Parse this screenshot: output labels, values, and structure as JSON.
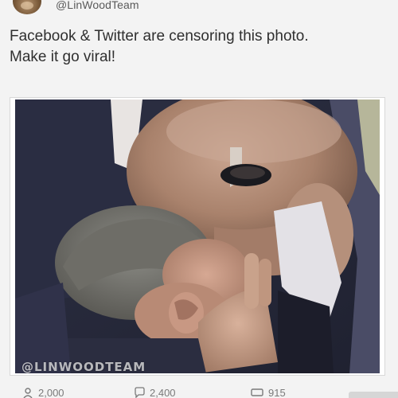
{
  "post": {
    "handle": "@LinWoodTeam",
    "text_lines": [
      "Facebook & Twitter are censoring this photo.",
      "Make it go viral!"
    ],
    "photo": {
      "watermark": "@LINWOODTEAM"
    },
    "actions": {
      "like_count": "2,000",
      "comment_count": "2,400",
      "share_count": "915"
    }
  },
  "colors": {
    "background": "#f3f3f3",
    "text": "#2f2f2f",
    "handle": "#5a5a5a",
    "action": "#7a7a7a"
  },
  "icons": {
    "avatar": "profile-photo",
    "like": "person-icon",
    "comment": "speech-bubble-icon",
    "share": "retweet-icon"
  }
}
